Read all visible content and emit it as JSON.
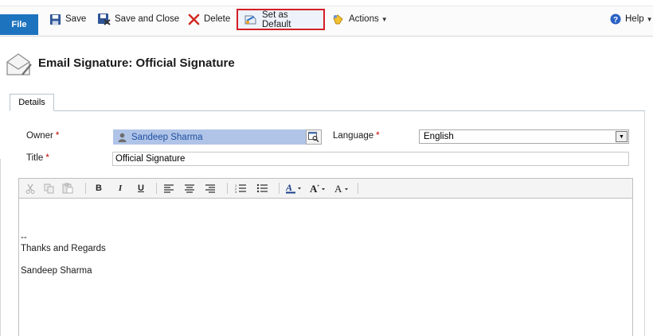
{
  "ribbon": {
    "file_label": "File",
    "save_label": "Save",
    "save_close_label": "Save and Close",
    "delete_label": "Delete",
    "set_default_label": "Set as Default",
    "actions_label": "Actions",
    "help_label": "Help"
  },
  "header": {
    "title": "Email Signature: Official Signature"
  },
  "tabs": [
    {
      "label": "Details"
    }
  ],
  "form": {
    "owner_label": "Owner",
    "owner_value": "Sandeep Sharma",
    "language_label": "Language",
    "language_value": "English",
    "title_label": "Title",
    "title_value": "Official Signature",
    "required_mark": "*"
  },
  "editor": {
    "toolbar": {
      "bold": "B",
      "italic": "I",
      "underline": "U"
    },
    "body": {
      "line1": "--",
      "line2": "Thanks and Regards",
      "line3": "Sandeep Sharma"
    }
  },
  "colors": {
    "file_tab": "#1e73be",
    "highlight_border": "#d41f26",
    "owner_bg": "#b0c4e8",
    "required": "#c00000"
  }
}
